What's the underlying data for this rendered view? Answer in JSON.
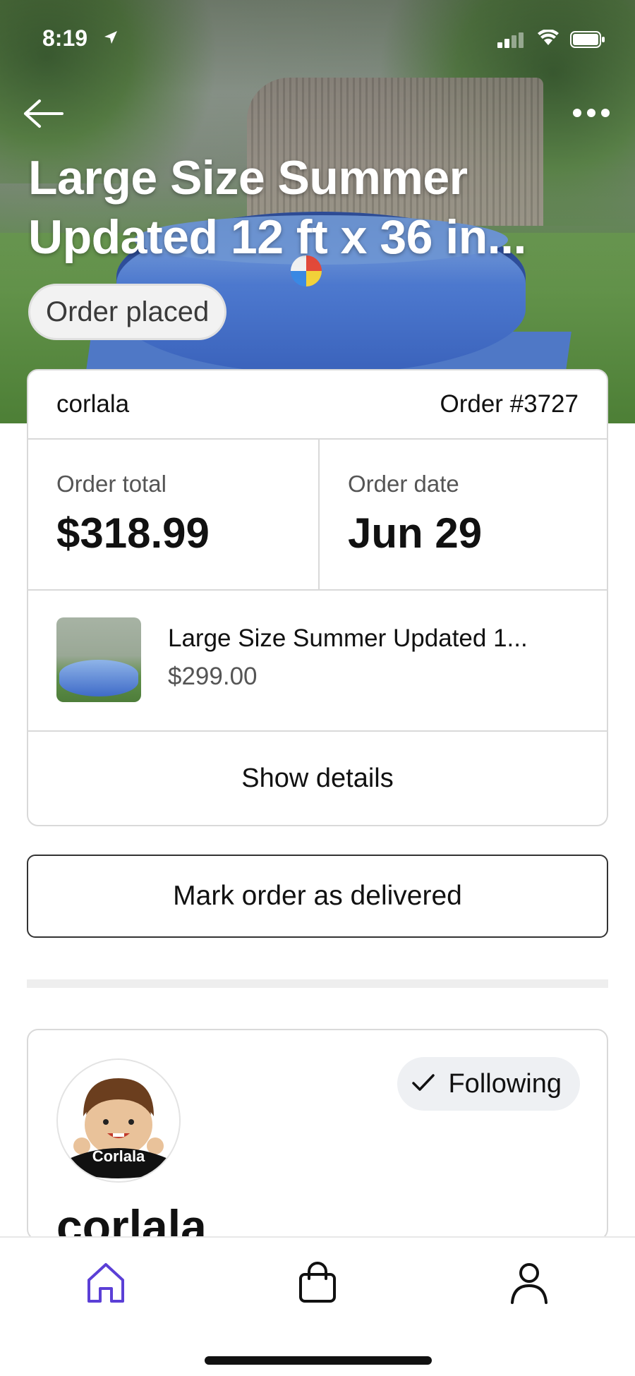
{
  "status_bar": {
    "time": "8:19"
  },
  "header": {
    "title": "Large Size Summer Updated 12 ft x 36 in...",
    "status": "Order placed"
  },
  "order": {
    "shop_name": "corlala",
    "order_number": "Order #3727",
    "total_label": "Order total",
    "total_value": "$318.99",
    "date_label": "Order date",
    "date_value": "Jun 29",
    "item_title": "Large Size Summer Updated 1...",
    "item_price": "$299.00",
    "show_details_label": "Show details"
  },
  "actions": {
    "mark_delivered_label": "Mark order as delivered"
  },
  "shop_card": {
    "avatar_label": "Corlala",
    "following_label": "Following",
    "name": "corlala"
  },
  "bottom_nav": {
    "items": [
      {
        "icon": "home-icon",
        "active": true
      },
      {
        "icon": "cart-icon",
        "active": false
      },
      {
        "icon": "profile-icon",
        "active": false
      }
    ],
    "active_color": "#5b3fd6"
  },
  "colors": {
    "accent": "#5b3fd6",
    "border": "#d9d9d9",
    "pill_bg": "#eef0f3"
  }
}
